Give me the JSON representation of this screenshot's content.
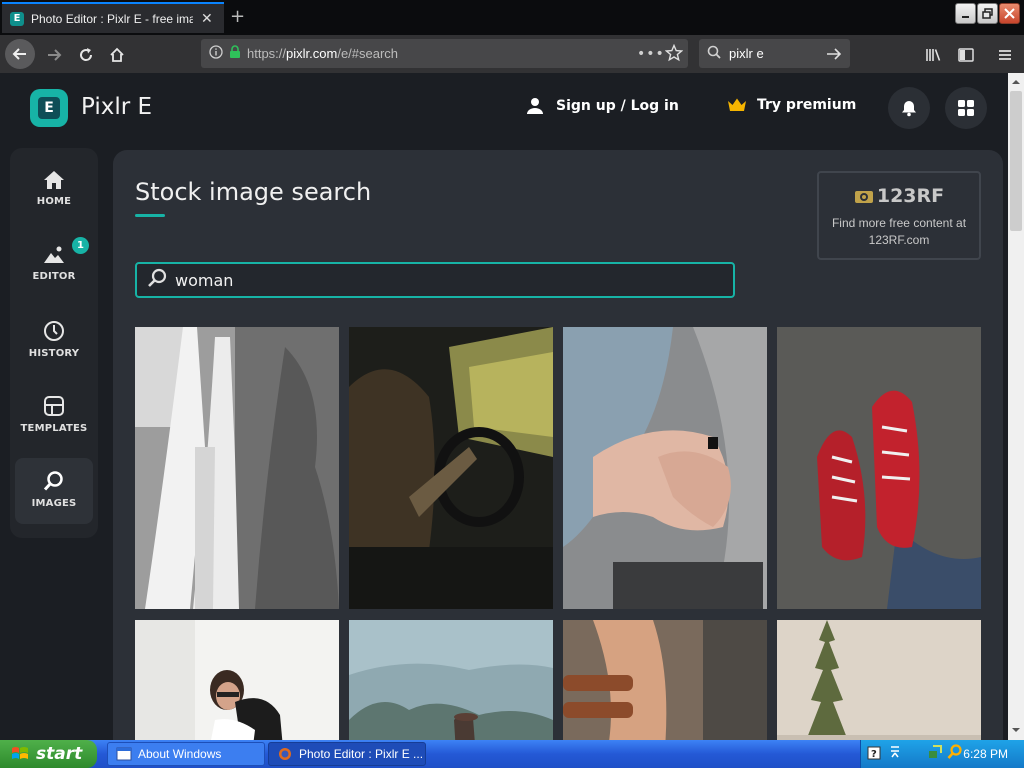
{
  "browser": {
    "tab_title": "Photo Editor : Pixlr E - free image",
    "url_prefix": "https://",
    "url_host": "pixlr.com",
    "url_path": "/e/#search",
    "search_value": "pixlr e"
  },
  "app": {
    "name": "Pixlr E",
    "signup_label": "Sign up / Log in",
    "premium_label": "Try premium"
  },
  "sidebar": {
    "items": [
      {
        "label": "HOME",
        "icon": "home-icon"
      },
      {
        "label": "EDITOR",
        "icon": "image-icon",
        "badge": "1"
      },
      {
        "label": "HISTORY",
        "icon": "clock-icon"
      },
      {
        "label": "TEMPLATES",
        "icon": "templates-icon"
      },
      {
        "label": "IMAGES",
        "icon": "search-icon"
      }
    ]
  },
  "main": {
    "heading": "Stock image search",
    "search_query": "woman",
    "promo_brand": "123RF",
    "promo_text": "Find more free content at 123RF.com"
  },
  "taskbar": {
    "start_label": "start",
    "items": [
      "About Windows",
      "Photo Editor : Pixlr E ..."
    ],
    "clock": "6:28 PM"
  },
  "colors": {
    "accent": "#17b3a6",
    "background": "#1b1e23",
    "panel": "#2c3037",
    "premium_crown": "#f5b400"
  }
}
